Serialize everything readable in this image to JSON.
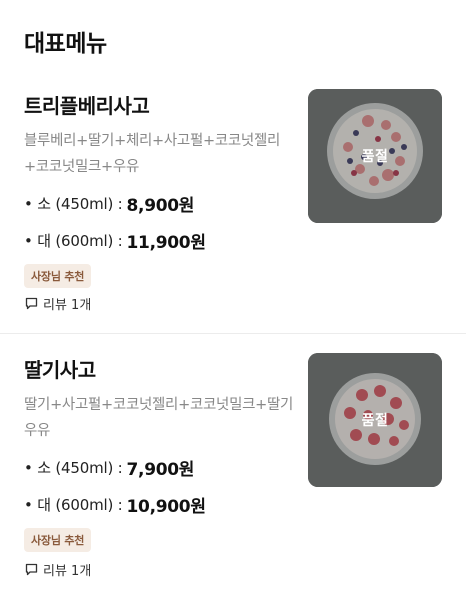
{
  "section_title": "대표메뉴",
  "items": [
    {
      "name": "트리플베리사고",
      "description": "블루베리+딸기+체리+사고펄+코코넛젤리+코코넛밀크+우유",
      "prices": [
        {
          "label": "• 소 (450ml) :",
          "value": "8,900원"
        },
        {
          "label": "• 대 (600ml) :",
          "value": "11,900원"
        }
      ],
      "badge": "사장님 추천",
      "review": "리뷰 1개",
      "soldout": "품절",
      "image_icon": "triple-berry-sago-bowl"
    },
    {
      "name": "딸기사고",
      "description": "딸기+사고펄+코코넛젤리+코코넛밀크+딸기우유",
      "prices": [
        {
          "label": "• 소 (450ml) :",
          "value": "7,900원"
        },
        {
          "label": "• 대 (600ml) :",
          "value": "10,900원"
        }
      ],
      "badge": "사장님 추천",
      "review": "리뷰 1개",
      "soldout": "품절",
      "image_icon": "strawberry-sago-bowl"
    }
  ],
  "colors": {
    "badge_bg": "#f5ece4",
    "badge_text": "#8a5a3c",
    "desc_text": "#888888",
    "thumb_bg": "#5a5e5e"
  }
}
